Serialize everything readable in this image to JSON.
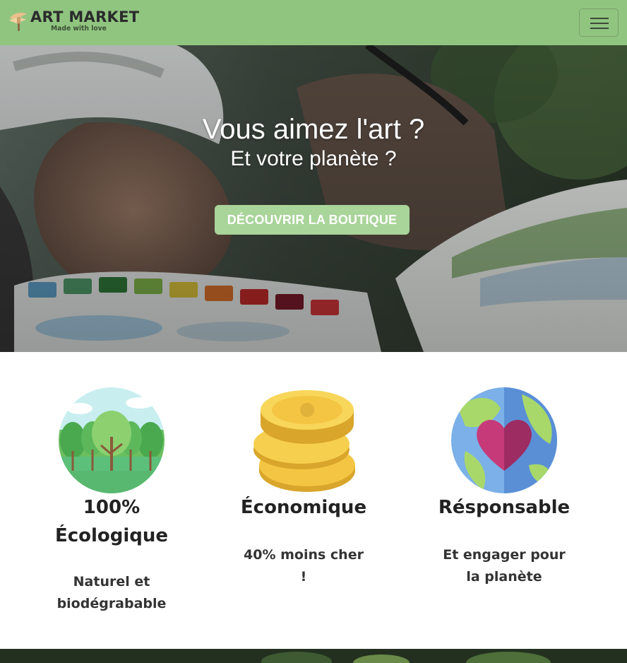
{
  "navbar": {
    "brand_title": "ART MARKET",
    "brand_tagline": "Made with love",
    "toggler_icon": "hamburger-menu-icon",
    "background_color": "#90c580"
  },
  "hero": {
    "title": "Vous aimez l'art ?",
    "subtitle": "Et votre planète ?",
    "cta_label": "DÉCOUVRIR LA BOUTIQUE",
    "cta_color": "#a9d49a",
    "background_image": "painter-with-watercolor-palette-photo"
  },
  "features": [
    {
      "icon": "forest-icon",
      "title": "100% Écologique",
      "text": "Naturel et biodégrabable"
    },
    {
      "icon": "gold-coins-icon",
      "title": "Économique",
      "text": "40% moins cher !"
    },
    {
      "icon": "earth-heart-icon",
      "title": "Résponsable",
      "text": "Et engager pour la planète"
    }
  ]
}
